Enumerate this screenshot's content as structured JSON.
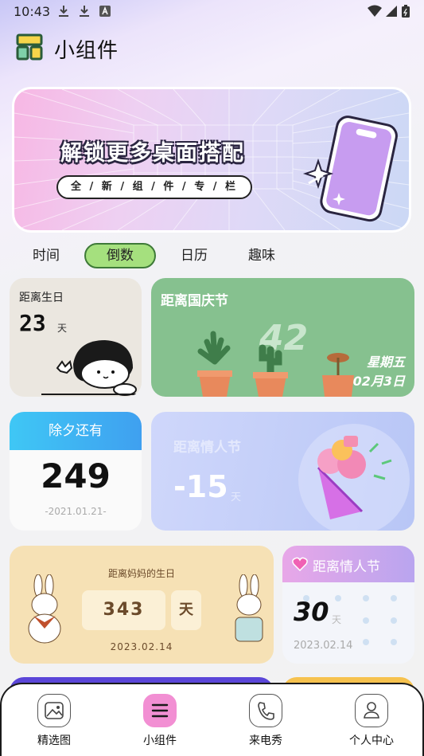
{
  "status": {
    "time": "10:43"
  },
  "app": {
    "title": "小组件"
  },
  "banner": {
    "title": "解锁更多桌面搭配",
    "subtitle": "全 / 新 / 组 / 件 / 专 / 栏"
  },
  "tabs": [
    {
      "label": "时间"
    },
    {
      "label": "倒数"
    },
    {
      "label": "日历"
    },
    {
      "label": "趣味"
    }
  ],
  "widgets": {
    "birthday": {
      "title": "距离生日",
      "days": "23",
      "unit": "天"
    },
    "national": {
      "title": "距离国庆节",
      "days": "42",
      "weekday": "星期五",
      "date": "02月3日"
    },
    "newyear": {
      "title": "除夕还有",
      "days": "249",
      "date": "-2021.01.21-"
    },
    "valentine_big": {
      "title": "距离情人节",
      "days": "-15",
      "unit": "天"
    },
    "mom": {
      "title": "距离妈妈的生日",
      "days": "343",
      "unit": "天",
      "date": "2023.02.14"
    },
    "valentine_small": {
      "title": "距离情人节",
      "days": "30",
      "unit": "天",
      "date": "2023.02.14"
    }
  },
  "nav": [
    {
      "label": "精选图"
    },
    {
      "label": "小组件"
    },
    {
      "label": "来电秀"
    },
    {
      "label": "个人中心"
    }
  ]
}
